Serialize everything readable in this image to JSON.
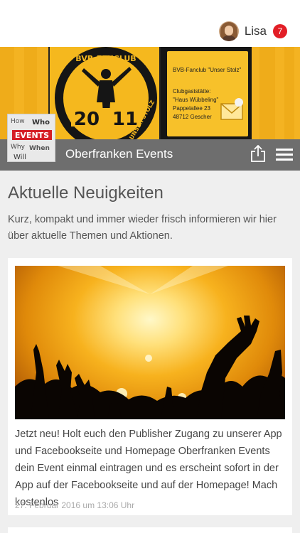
{
  "user": {
    "name": "Lisa",
    "notification_count": "7",
    "avatar": "profile-photo"
  },
  "banner": {
    "logo_text_top": "BVB-FANCLUB",
    "logo_text_side": "UNSER STOLZ",
    "logo_year_left": "20",
    "logo_year_right": "11",
    "info_lines": [
      "BVB-Fanclub \"Unser Stolz\"",
      "Clubgaststätte:",
      "\"Haus Wübbeling\"",
      "Pappelallee 23",
      "48712 Gescher"
    ],
    "colors": {
      "yellow": "#f4b322",
      "black": "#151515"
    }
  },
  "header": {
    "title": "Oberfranken Events",
    "thumb_label": "EVENTS",
    "thumb_words": [
      "How",
      "Who",
      "Why",
      "When",
      "Will"
    ]
  },
  "main": {
    "heading": "Aktuelle Neuigkeiten",
    "intro": "Kurz, kompakt und immer wieder frisch informieren wir hier über aktuelle Themen und Aktionen.",
    "posts": [
      {
        "image": "concert-crowd-photo",
        "text": "Jetzt neu! Holt euch den Publisher Zugang zu unserer App und Facebookseite und Homepage Oberfranken Events dein Event einmal eintragen und es erscheint sofort in der App auf der Facebookseite und auf der Homepage! Mach kostenlos",
        "date": "27. Februar 2016 um 13:06 Uhr"
      }
    ]
  },
  "icons": {
    "share": "share-icon",
    "menu": "hamburger-menu-icon"
  },
  "colors": {
    "accent_badge": "#e21e26",
    "titlebar": "#6e6e6e"
  }
}
